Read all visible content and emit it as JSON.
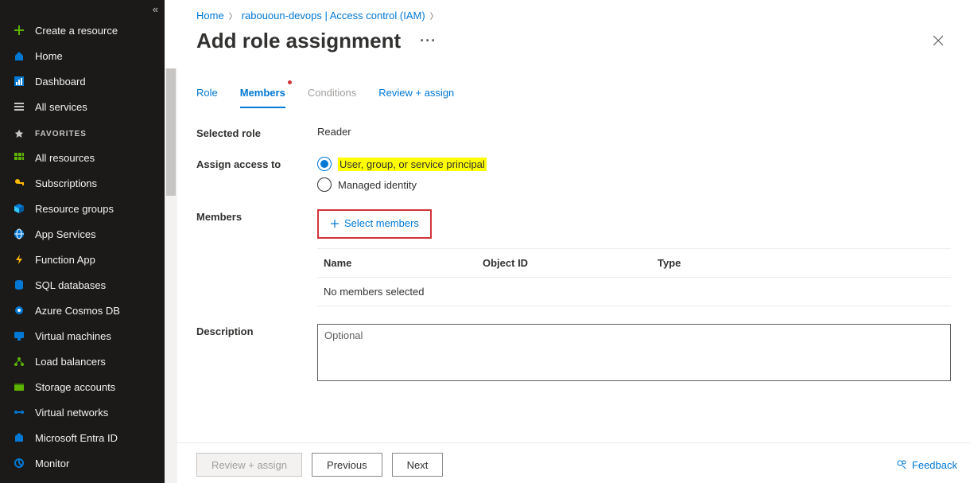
{
  "sidebar": {
    "items": [
      {
        "label": "Create a resource"
      },
      {
        "label": "Home"
      },
      {
        "label": "Dashboard"
      },
      {
        "label": "All services"
      }
    ],
    "favorites_label": "FAVORITES",
    "favorites": [
      {
        "label": "All resources"
      },
      {
        "label": "Subscriptions"
      },
      {
        "label": "Resource groups"
      },
      {
        "label": "App Services"
      },
      {
        "label": "Function App"
      },
      {
        "label": "SQL databases"
      },
      {
        "label": "Azure Cosmos DB"
      },
      {
        "label": "Virtual machines"
      },
      {
        "label": "Load balancers"
      },
      {
        "label": "Storage accounts"
      },
      {
        "label": "Virtual networks"
      },
      {
        "label": "Microsoft Entra ID"
      },
      {
        "label": "Monitor"
      }
    ]
  },
  "breadcrumb": {
    "home": "Home",
    "scope": "rabououn-devops | Access control (IAM)"
  },
  "page": {
    "title": "Add role assignment"
  },
  "tabs": {
    "role": "Role",
    "members": "Members",
    "conditions": "Conditions",
    "review": "Review + assign"
  },
  "form": {
    "selected_role_label": "Selected role",
    "selected_role_value": "Reader",
    "assign_access_label": "Assign access to",
    "assign_opt1": "User, group, or service principal",
    "assign_opt2": "Managed identity",
    "members_label": "Members",
    "select_members_label": "Select members",
    "table": {
      "name": "Name",
      "object_id": "Object ID",
      "type": "Type",
      "empty": "No members selected"
    },
    "description_label": "Description",
    "description_placeholder": "Optional"
  },
  "footer": {
    "review": "Review + assign",
    "previous": "Previous",
    "next": "Next",
    "feedback": "Feedback"
  }
}
